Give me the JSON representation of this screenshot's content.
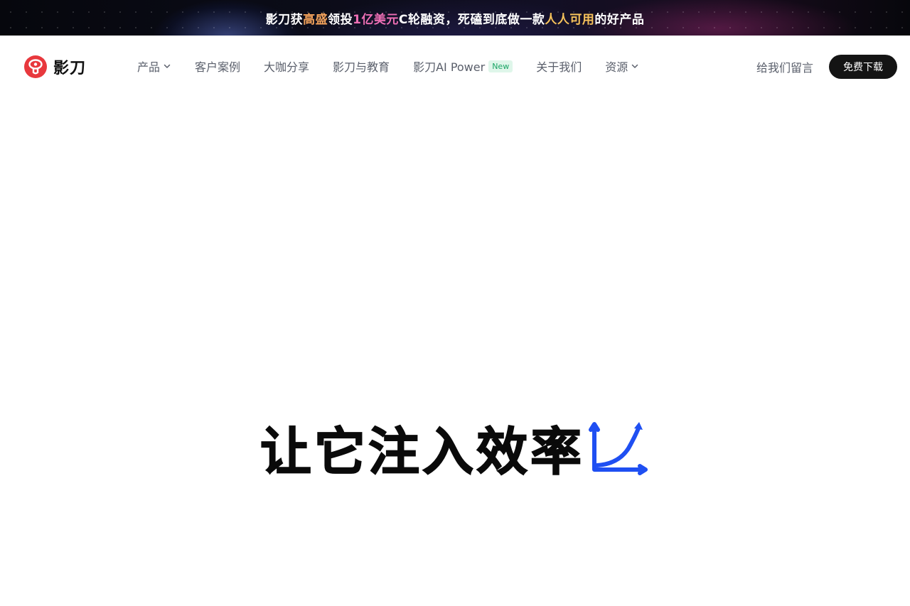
{
  "banner": {
    "part1": "影刀获",
    "part2": "高盛",
    "part3": "领投",
    "part4": "1亿美元",
    "part5": "C轮融资，死磕到底做一款",
    "part6": "人人可用",
    "part7": "的好产品"
  },
  "logo": {
    "text": "影刀",
    "icon": "yingdao-logo-icon"
  },
  "nav": {
    "items": [
      {
        "label": "产品",
        "has_dropdown": true
      },
      {
        "label": "客户案例",
        "has_dropdown": false
      },
      {
        "label": "大咖分享",
        "has_dropdown": false
      },
      {
        "label": "影刀与教育",
        "has_dropdown": false
      },
      {
        "label": "影刀AI Power",
        "badge": "New",
        "has_dropdown": false
      },
      {
        "label": "关于我们",
        "has_dropdown": false
      },
      {
        "label": "资源",
        "has_dropdown": true
      }
    ],
    "message_link": "给我们留言",
    "download_button": "免费下载"
  },
  "hero": {
    "title": "让它注入效率",
    "icon": "growth-chart-icon"
  },
  "colors": {
    "banner_highlight_orange": "#f2a25b",
    "banner_highlight_pink": "#ee6fb5",
    "banner_highlight_gold": "#f6c25b",
    "banner_highlight_purple": "#b58cff",
    "logo_red": "#e8383d",
    "new_badge_green": "#1aa565",
    "hero_icon_blue": "#1f4ff2",
    "button_black": "#141414"
  }
}
